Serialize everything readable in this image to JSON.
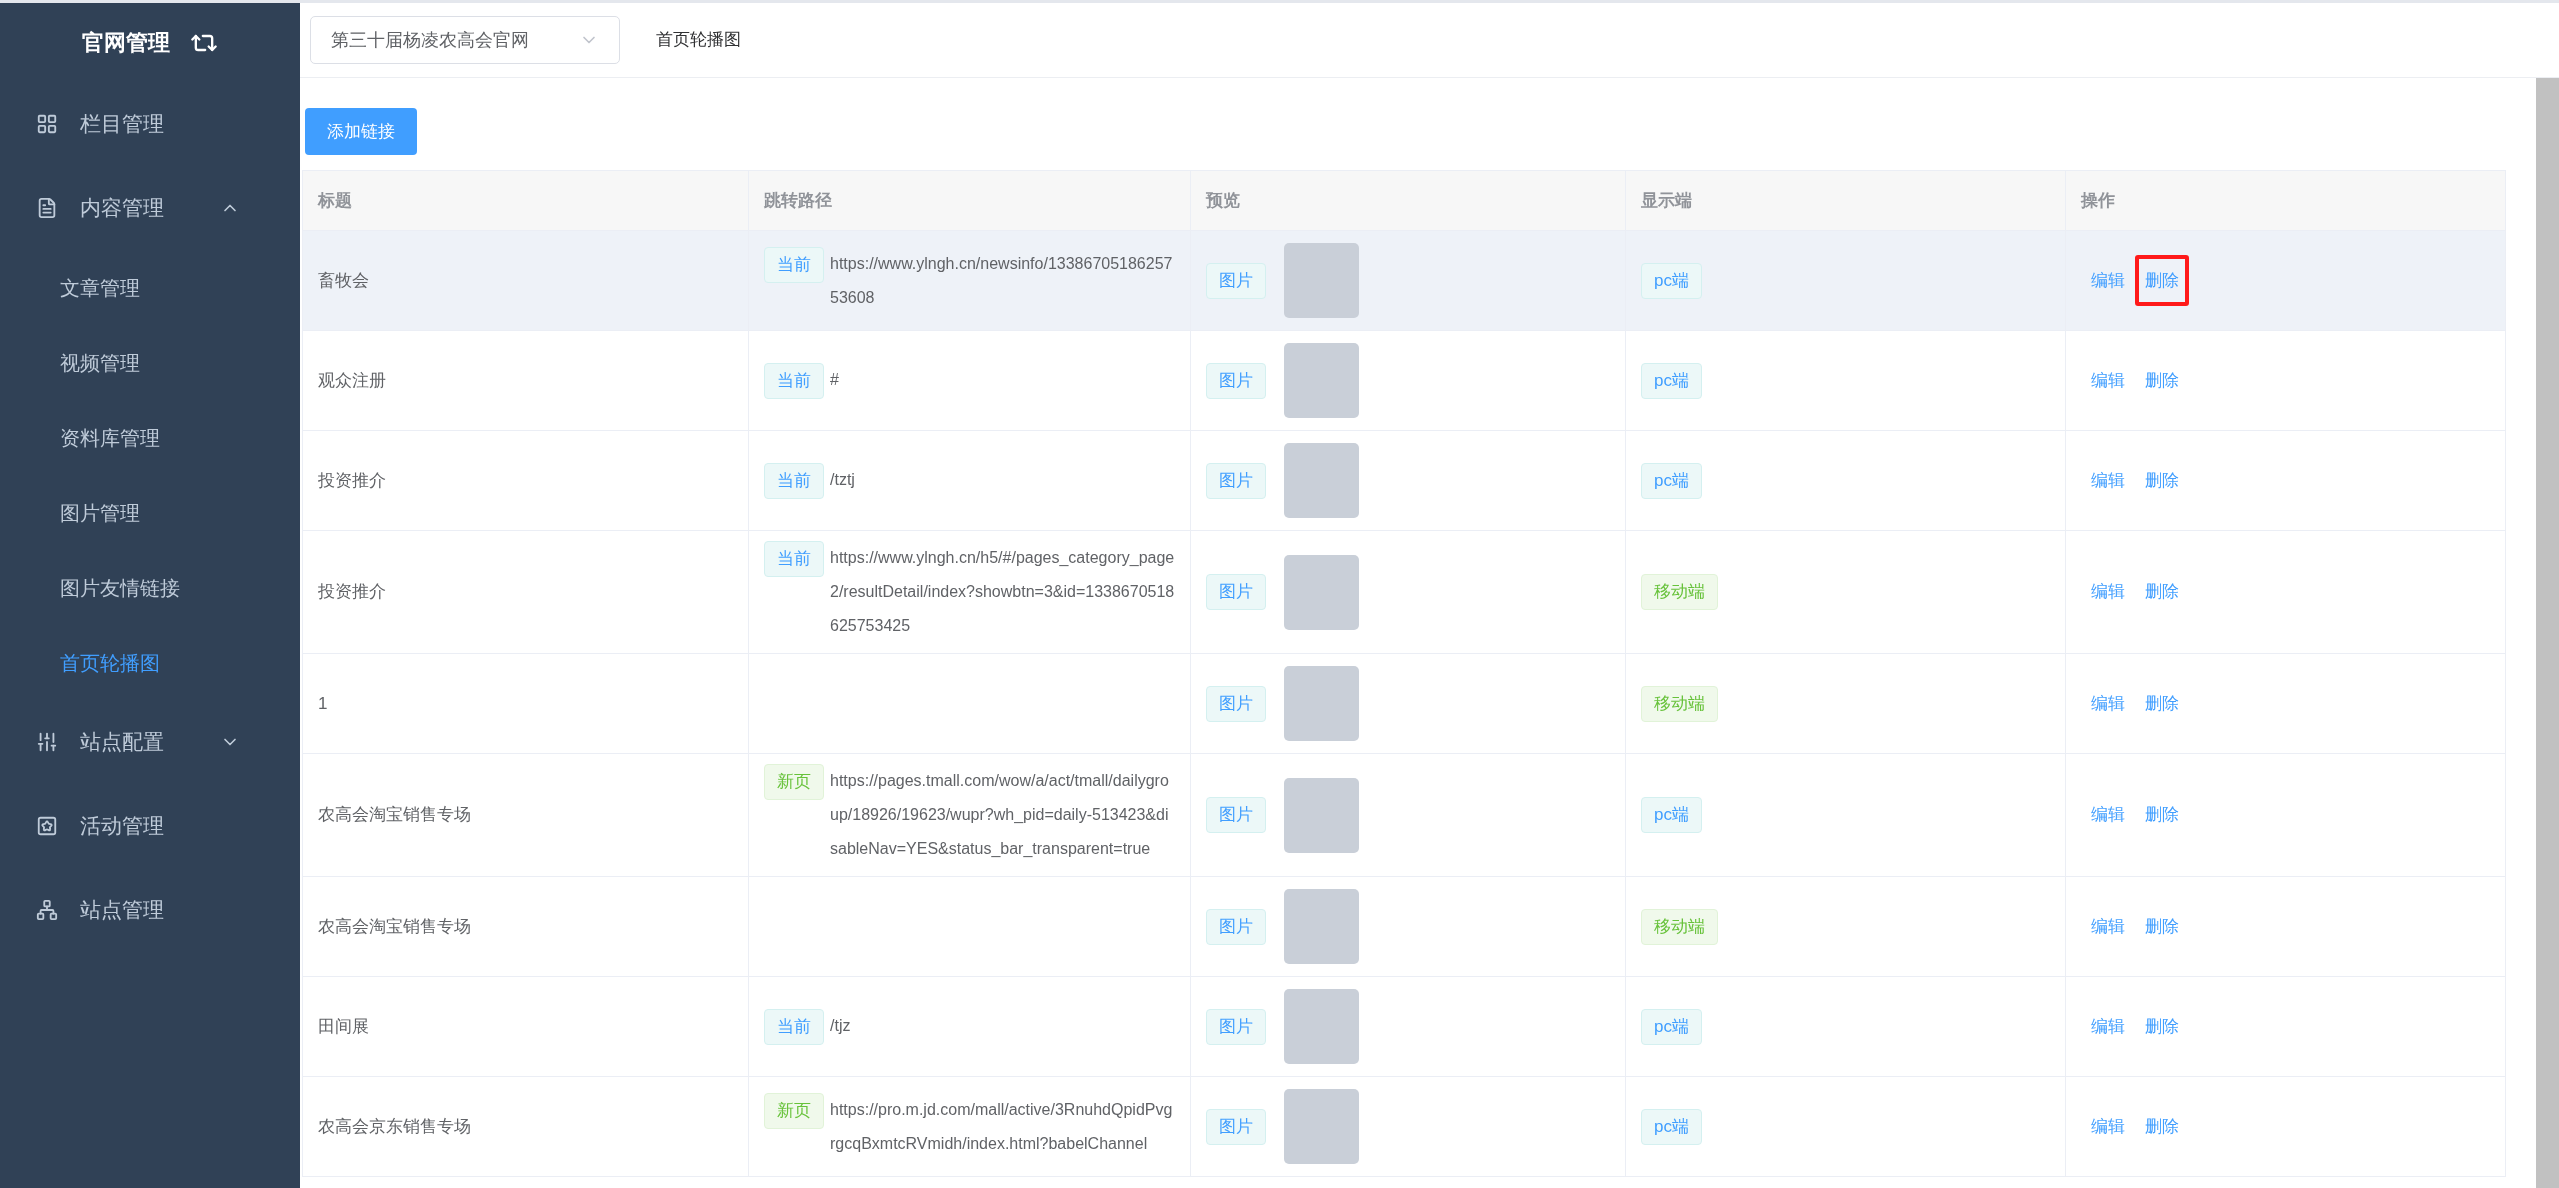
{
  "sidebar": {
    "title": "官网管理",
    "items": [
      {
        "label": "栏目管理"
      },
      {
        "label": "内容管理",
        "expanded": true,
        "children": [
          {
            "label": "文章管理",
            "selected": false
          },
          {
            "label": "视频管理",
            "selected": false
          },
          {
            "label": "资料库管理",
            "selected": false
          },
          {
            "label": "图片管理",
            "selected": false
          },
          {
            "label": "图片友情链接",
            "selected": false
          },
          {
            "label": "首页轮播图",
            "selected": true
          }
        ]
      },
      {
        "label": "站点配置",
        "expanded": false
      },
      {
        "label": "活动管理"
      },
      {
        "label": "站点管理"
      }
    ]
  },
  "header": {
    "site_select": {
      "value": "第三十届杨凌农高会官网"
    },
    "breadcrumb": "首页轮播图"
  },
  "add_button": "添加链接",
  "table": {
    "columns": [
      "标题",
      "跳转路径",
      "预览",
      "显示端",
      "操作"
    ],
    "rows": [
      {
        "title": "畜牧会",
        "highlighted": true,
        "path_tag": {
          "kind": "current",
          "label": "当前"
        },
        "path": "https://www.ylngh.cn/newsinfo/1338670518625753608",
        "preview_tag": "图片",
        "display": {
          "kind": "pc",
          "label": "pc端"
        },
        "actions": [
          {
            "label": "编辑",
            "boxed": false
          },
          {
            "label": "删除",
            "boxed": true
          }
        ]
      },
      {
        "title": "观众注册",
        "highlighted": false,
        "path_tag": {
          "kind": "current",
          "label": "当前"
        },
        "path": "#",
        "preview_tag": "图片",
        "display": {
          "kind": "pc",
          "label": "pc端"
        },
        "actions": [
          {
            "label": "编辑",
            "boxed": false
          },
          {
            "label": "删除",
            "boxed": false
          }
        ]
      },
      {
        "title": "投资推介",
        "highlighted": false,
        "path_tag": {
          "kind": "current",
          "label": "当前"
        },
        "path": "/tztj",
        "preview_tag": "图片",
        "display": {
          "kind": "pc",
          "label": "pc端"
        },
        "actions": [
          {
            "label": "编辑",
            "boxed": false
          },
          {
            "label": "删除",
            "boxed": false
          }
        ]
      },
      {
        "title": "投资推介",
        "highlighted": false,
        "path_tag": {
          "kind": "current",
          "label": "当前"
        },
        "path": "https://www.ylngh.cn/h5/#/pages_category_page2/resultDetail/index?showbtn=3&id=1338670518625753425",
        "preview_tag": "图片",
        "display": {
          "kind": "mobile",
          "label": "移动端"
        },
        "actions": [
          {
            "label": "编辑",
            "boxed": false
          },
          {
            "label": "删除",
            "boxed": false
          }
        ]
      },
      {
        "title": "1",
        "highlighted": false,
        "preview_tag": "图片",
        "display": {
          "kind": "mobile",
          "label": "移动端"
        },
        "actions": [
          {
            "label": "编辑",
            "boxed": false
          },
          {
            "label": "删除",
            "boxed": false
          }
        ]
      },
      {
        "title": "农高会淘宝销售专场",
        "highlighted": false,
        "path_tag": {
          "kind": "new",
          "label": "新页"
        },
        "path": "https://pages.tmall.com/wow/a/act/tmall/dailygroup/18926/19623/wupr?wh_pid=daily-513423&disableNav=YES&status_bar_transparent=true",
        "preview_tag": "图片",
        "display": {
          "kind": "pc",
          "label": "pc端"
        },
        "actions": [
          {
            "label": "编辑",
            "boxed": false
          },
          {
            "label": "删除",
            "boxed": false
          }
        ]
      },
      {
        "title": "农高会淘宝销售专场",
        "highlighted": false,
        "preview_tag": "图片",
        "display": {
          "kind": "mobile",
          "label": "移动端"
        },
        "actions": [
          {
            "label": "编辑",
            "boxed": false
          },
          {
            "label": "删除",
            "boxed": false
          }
        ]
      },
      {
        "title": "田间展",
        "highlighted": false,
        "path_tag": {
          "kind": "current",
          "label": "当前"
        },
        "path": "/tjz",
        "preview_tag": "图片",
        "display": {
          "kind": "pc",
          "label": "pc端"
        },
        "actions": [
          {
            "label": "编辑",
            "boxed": false
          },
          {
            "label": "删除",
            "boxed": false
          }
        ]
      },
      {
        "title": "农高会京东销售专场",
        "highlighted": false,
        "path_tag": {
          "kind": "new",
          "label": "新页"
        },
        "path": "https://pro.m.jd.com/mall/active/3RnuhdQpidPvgrgcqBxmtcRVmidh/index.html?babelChannel",
        "preview_tag": "图片",
        "display": {
          "kind": "pc",
          "label": "pc端"
        },
        "actions": [
          {
            "label": "编辑",
            "boxed": false
          },
          {
            "label": "删除",
            "boxed": false
          }
        ]
      }
    ]
  }
}
